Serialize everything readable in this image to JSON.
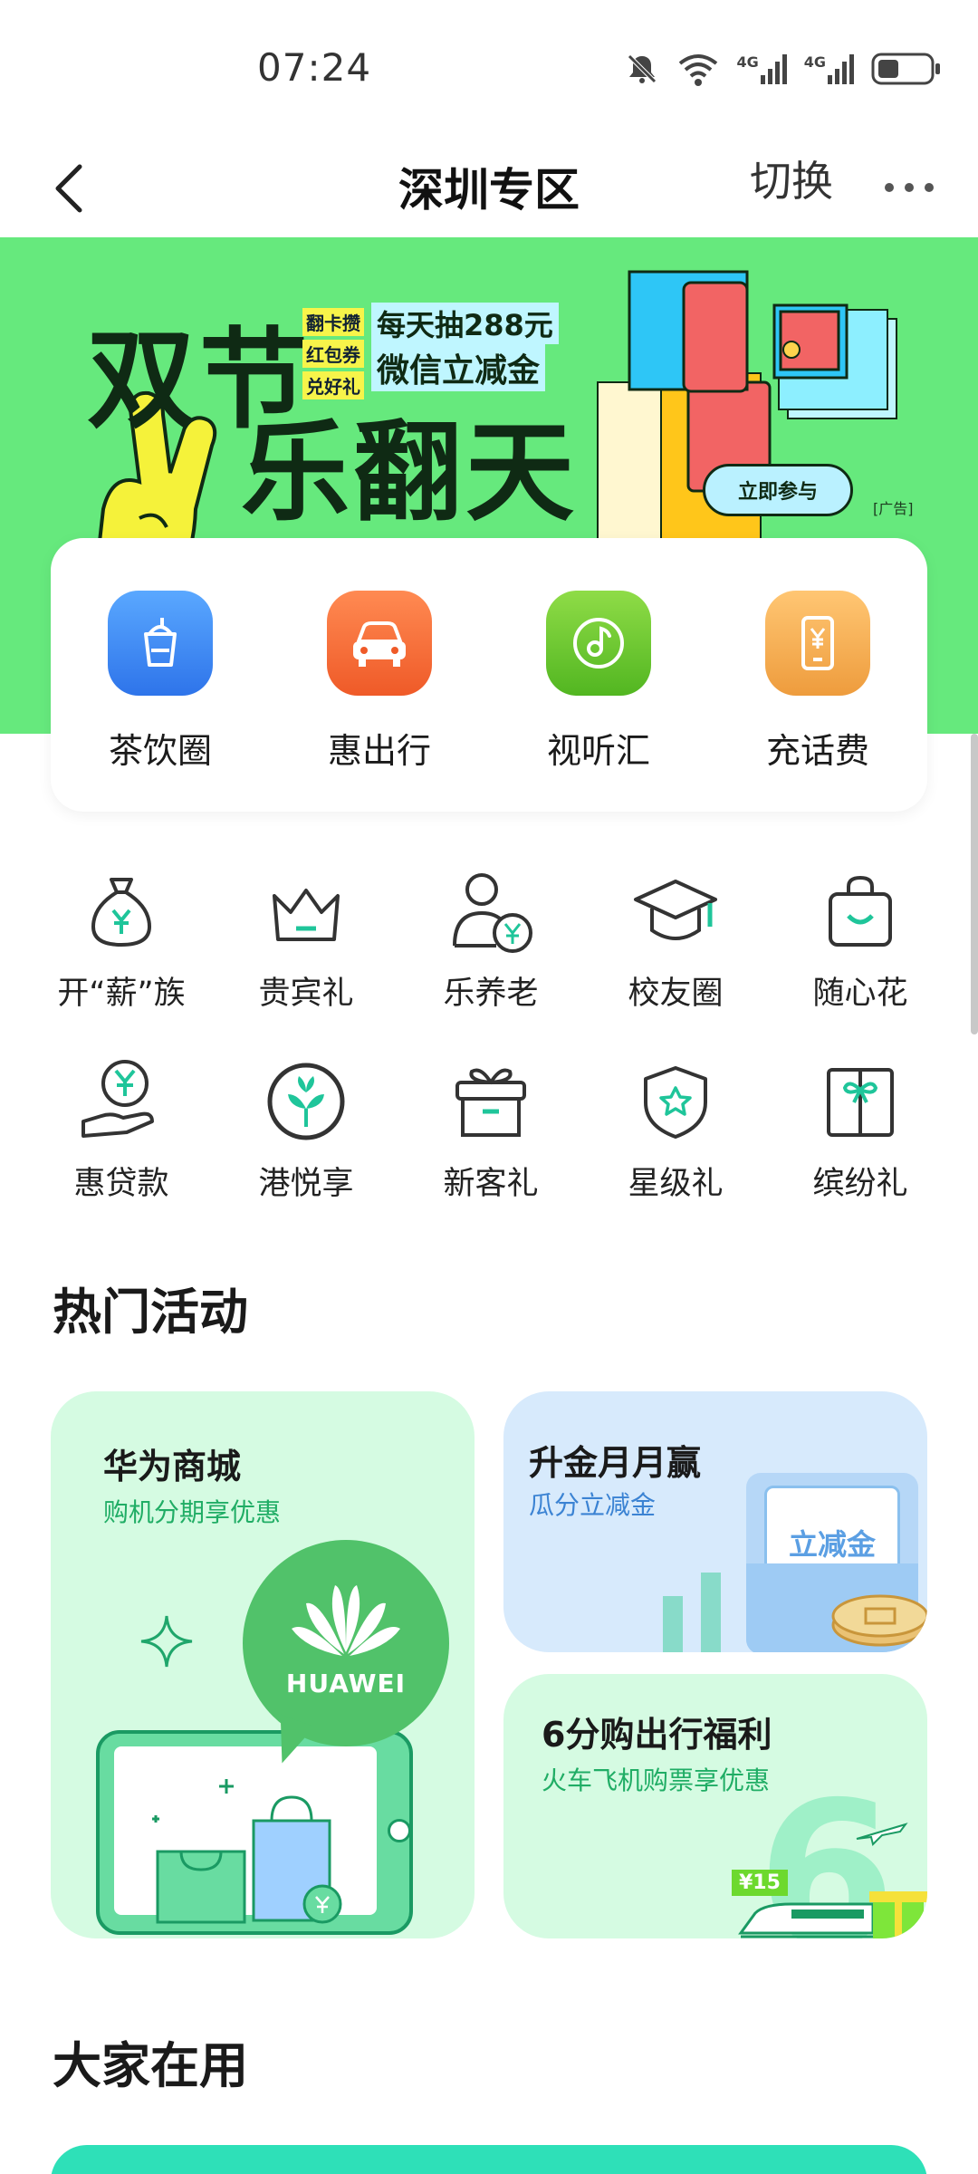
{
  "status_bar": {
    "time": "07:24",
    "network_left": "4G",
    "network_right": "4G"
  },
  "nav": {
    "title": "深圳专区",
    "switch_label": "切换"
  },
  "banner": {
    "title_line1": "双节",
    "title_line2": "乐翻天",
    "tags": [
      "翻卡攒",
      "红包券",
      "兑好礼"
    ],
    "prize_line1": "每天抽288元",
    "prize_line2": "微信立减金",
    "join_label": "立即参与",
    "ad_label": "[广告]",
    "bg_color": "#66e97d"
  },
  "quick_items": [
    {
      "label": "茶饮圈",
      "icon": "tea-cup-icon",
      "color": "#3b8cf3"
    },
    {
      "label": "惠出行",
      "icon": "car-icon",
      "color": "#f26a37"
    },
    {
      "label": "视听汇",
      "icon": "music-note-icon",
      "color": "#69cc2e"
    },
    {
      "label": "充话费",
      "icon": "phone-bill-icon",
      "color": "#f1ad4e"
    }
  ],
  "grid_items": [
    [
      {
        "label": "开“薪”族",
        "icon": "money-bag-icon"
      },
      {
        "label": "贵宾礼",
        "icon": "crown-icon"
      },
      {
        "label": "乐养老",
        "icon": "person-coin-icon"
      },
      {
        "label": "校友圈",
        "icon": "graduation-cap-icon"
      },
      {
        "label": "随心花",
        "icon": "shopping-bag-icon"
      }
    ],
    [
      {
        "label": "惠贷款",
        "icon": "hand-coin-icon"
      },
      {
        "label": "港悦享",
        "icon": "bauhinia-icon"
      },
      {
        "label": "新客礼",
        "icon": "gift-box-icon"
      },
      {
        "label": "星级礼",
        "icon": "star-shield-icon"
      },
      {
        "label": "缤纷礼",
        "icon": "present-icon"
      }
    ]
  ],
  "hot_section": {
    "title": "热门活动",
    "cards": [
      {
        "title": "华为商城",
        "subtitle": "购机分期享优惠",
        "logo_text": "HUAWEI"
      },
      {
        "title": "升金月月赢",
        "subtitle": "瓜分立减金",
        "badge_text": "立减金"
      },
      {
        "title": "6分购出行福利",
        "subtitle": "火车飞机购票享优惠",
        "tag_text": "¥15"
      }
    ]
  },
  "popular_section": {
    "title": "大家在用"
  },
  "colors": {
    "accent_green": "#21b65c",
    "icon_stroke": "#333333",
    "icon_accent": "#1fc59a"
  }
}
